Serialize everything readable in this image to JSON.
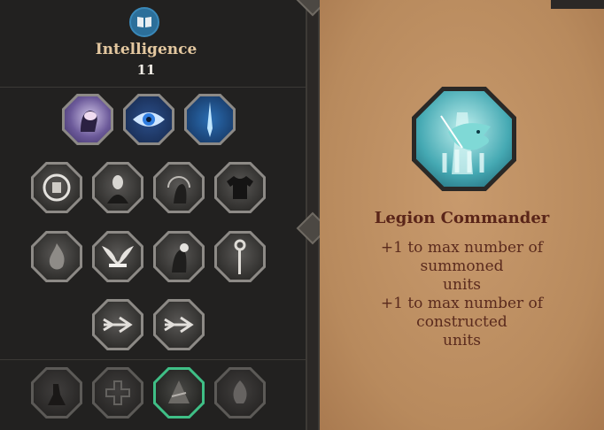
{
  "stat": {
    "name": "Intelligence",
    "value": "11",
    "icon": "book-icon"
  },
  "perk_tree": {
    "row1": [
      "brain-icon",
      "eye-icon",
      "blade-icon"
    ],
    "row2": [
      "spirit-circle-icon",
      "masked-figure-icon",
      "swirl-head-icon",
      "shirt-icon"
    ],
    "row3": [
      "flame-icon",
      "wings-book-icon",
      "head-orb-icon",
      "staff-icon"
    ],
    "row4": [
      "arrow-right-icon",
      "arrow-right-icon"
    ],
    "row5": [
      "warrior-icon",
      "cross-icon",
      "legion-icon",
      "flame-pillar-icon"
    ],
    "selected": "legion-icon"
  },
  "detail": {
    "icon": "wolf-spirit-icon",
    "title": "Legion Commander",
    "lines": [
      "+1 to max number of summoned",
      "units",
      "+1 to max number of constructed",
      "units"
    ]
  },
  "colors": {
    "selected_border": "#3fbf86",
    "title": "#5a2519",
    "parchment": "#c89a6d"
  }
}
